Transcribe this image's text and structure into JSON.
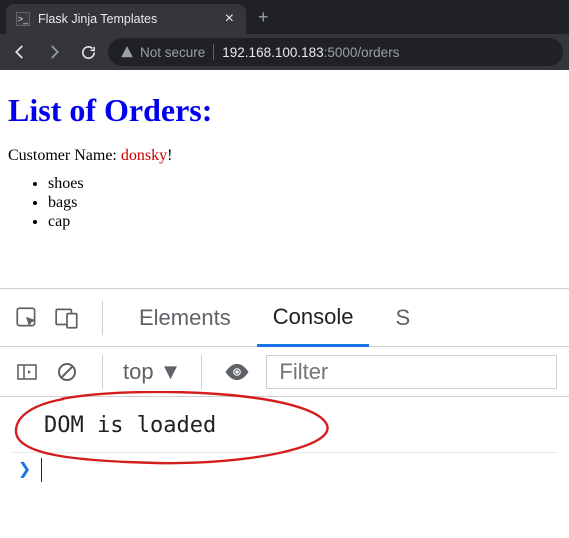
{
  "browser": {
    "tab": {
      "title": "Flask Jinja Templates"
    },
    "address": {
      "not_secure": "Not secure",
      "host": "192.168.100.183",
      "port_path": ":5000/orders"
    }
  },
  "page": {
    "heading": "List of Orders:",
    "customer_label": "Customer Name: ",
    "customer_name": "donsky",
    "customer_suffix": "!",
    "orders": [
      "shoes",
      "bags",
      "cap"
    ]
  },
  "devtools": {
    "tabs": {
      "elements": "Elements",
      "console": "Console",
      "sources_initial": "S"
    },
    "context": "top",
    "filter_placeholder": "Filter",
    "console_message": "DOM is loaded"
  }
}
